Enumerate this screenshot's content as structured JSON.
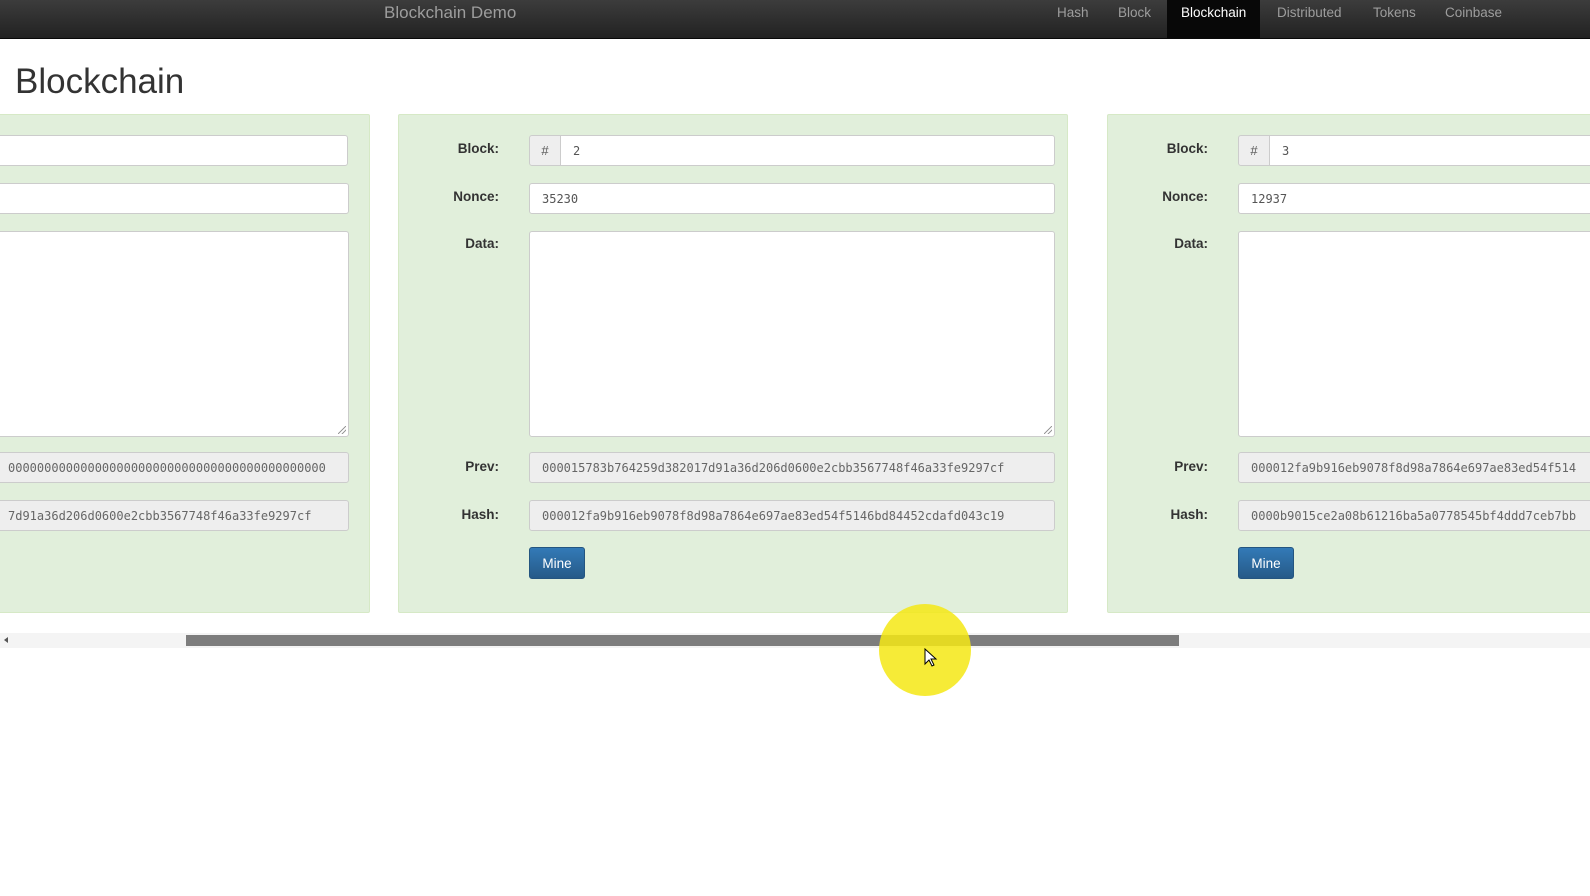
{
  "navbar": {
    "brand": "Blockchain Demo",
    "items": [
      "Hash",
      "Block",
      "Blockchain",
      "Distributed",
      "Tokens",
      "Coinbase"
    ],
    "active": "Blockchain"
  },
  "page": {
    "title": "Blockchain"
  },
  "labels": {
    "block": "Block:",
    "nonce": "Nonce:",
    "data": "Data:",
    "prev": "Prev:",
    "hash": "Hash:",
    "mine": "Mine",
    "hash_prefix": "#"
  },
  "blocks": [
    {
      "number": "",
      "nonce": "",
      "data": "",
      "prev": "00000000000000000000000000000000000000000000",
      "hash": "7d91a36d206d0600e2cbb3567748f46a33fe9297cf"
    },
    {
      "number": "2",
      "nonce": "35230",
      "data": "",
      "prev": "000015783b764259d382017d91a36d206d0600e2cbb3567748f46a33fe9297cf",
      "hash": "000012fa9b916eb9078f8d98a7864e697ae83ed54f5146bd84452cdafd043c19"
    },
    {
      "number": "3",
      "nonce": "12937",
      "data": "",
      "prev": "000012fa9b916eb9078f8d98a7864e697ae83ed54f514",
      "hash": "0000b9015ce2a08b61216ba5a0778545bf4ddd7ceb7bb"
    }
  ],
  "scrollbar": {
    "position": 0.24
  },
  "colors": {
    "card_bg": "#e1efdb",
    "navbar_bg": "#222222",
    "button": "#337ab7",
    "cursor_highlight": "#f5e814"
  }
}
